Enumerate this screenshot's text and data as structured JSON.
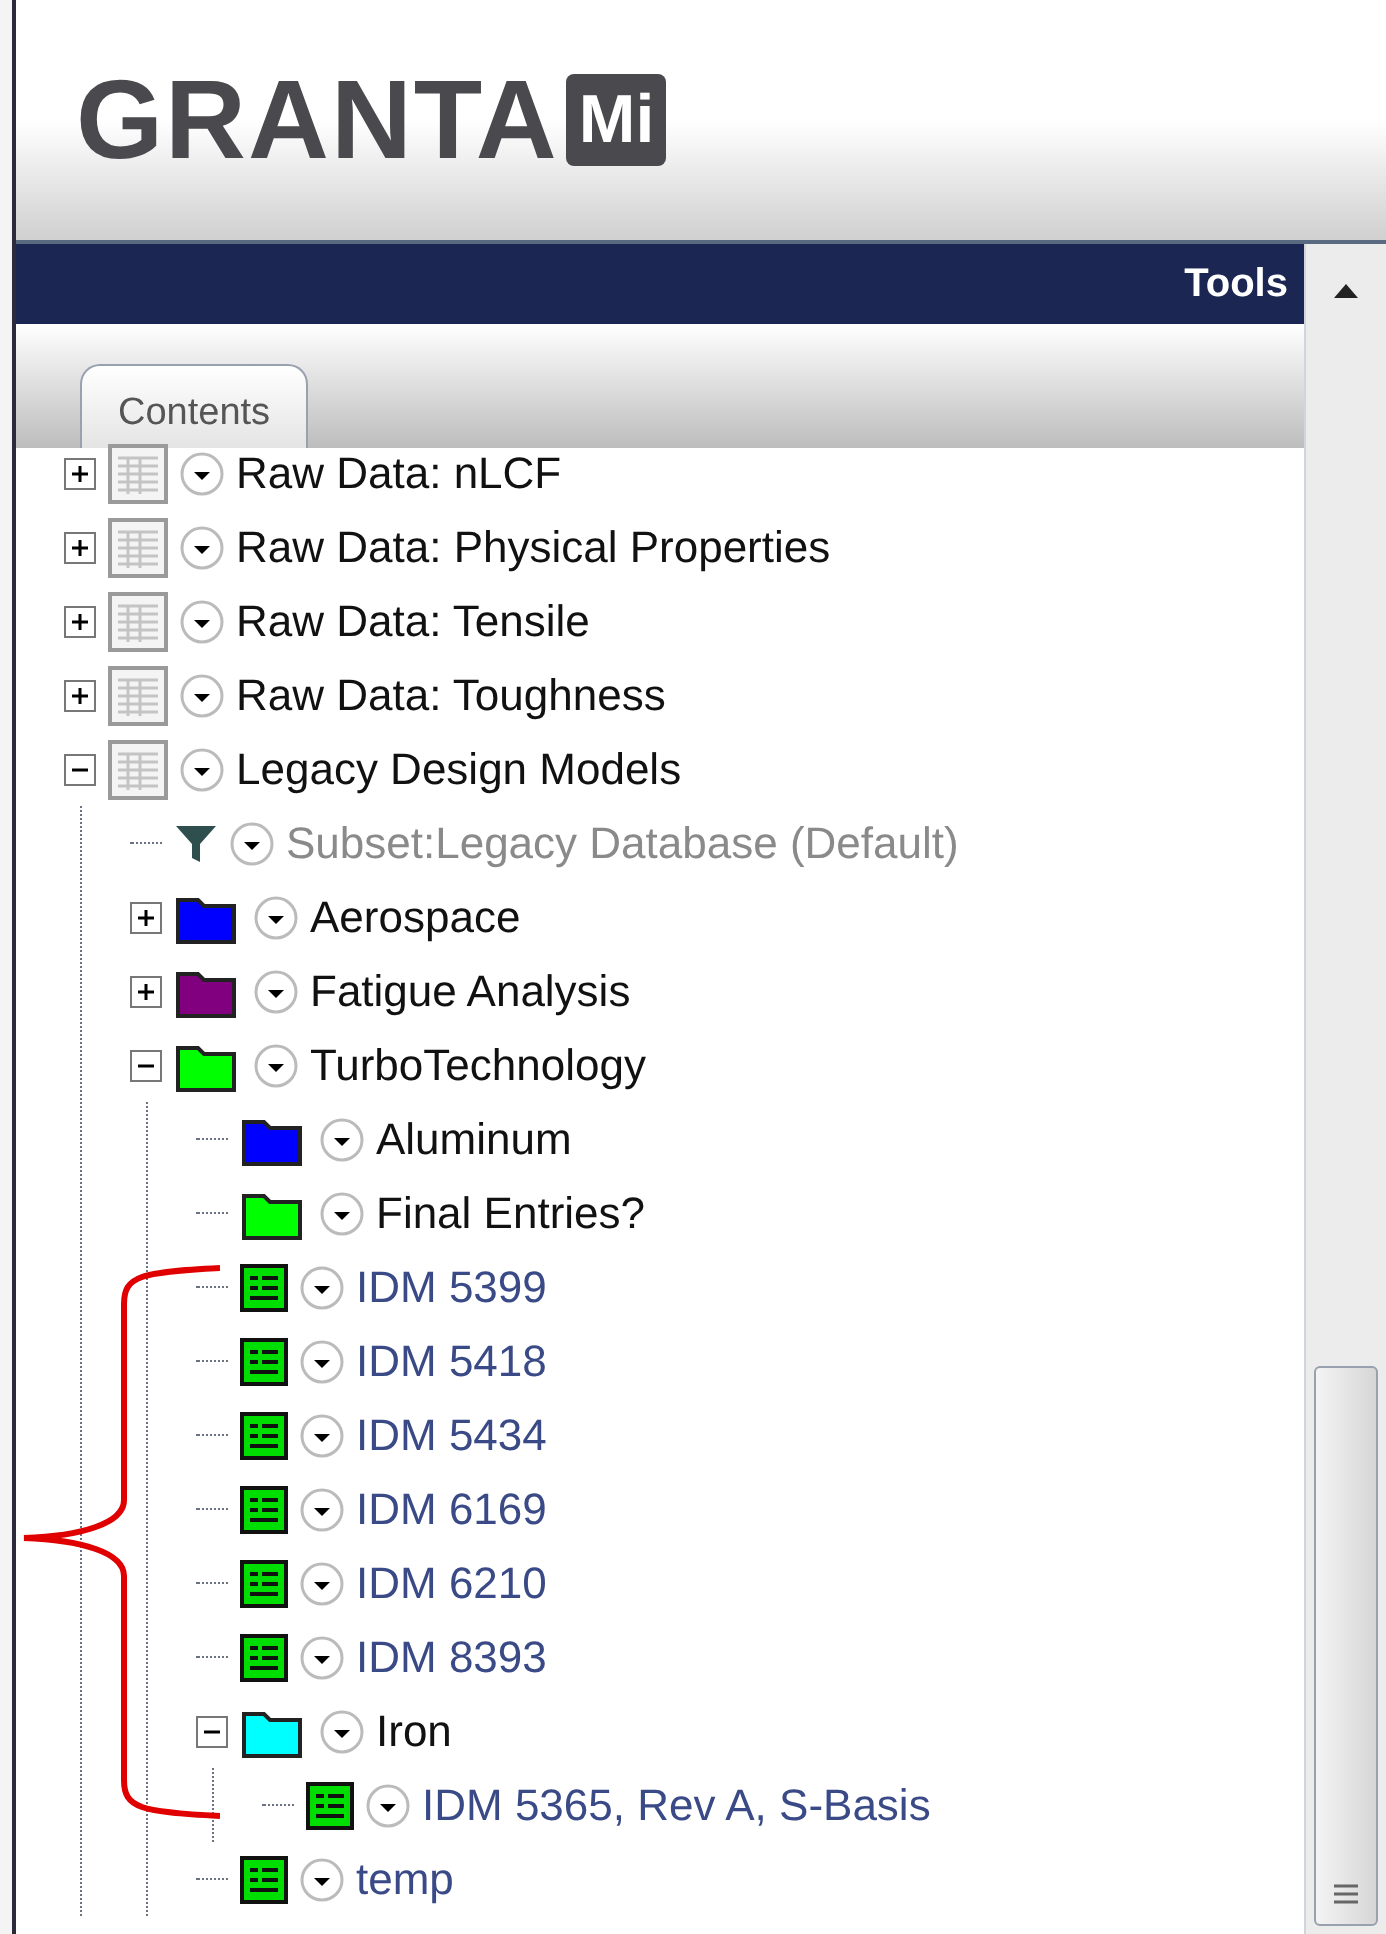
{
  "logo": {
    "name": "GRANTA",
    "badge": "Mi"
  },
  "header": {
    "title": "Tools"
  },
  "tabs": [
    {
      "label": "Contents",
      "selected": true
    }
  ],
  "tree": [
    {
      "kind": "table",
      "label": "Raw Data: nLCF",
      "expanded": false
    },
    {
      "kind": "table",
      "label": "Raw Data: Physical Properties",
      "expanded": false
    },
    {
      "kind": "table",
      "label": "Raw Data: Tensile",
      "expanded": false
    },
    {
      "kind": "table",
      "label": "Raw Data: Toughness",
      "expanded": false
    },
    {
      "kind": "table",
      "label": "Legacy Design Models",
      "expanded": true,
      "children": [
        {
          "kind": "subset",
          "label": "Subset:Legacy Database (Default)"
        },
        {
          "kind": "folder",
          "label": "Aerospace",
          "color": "#0000ff",
          "expanded": false
        },
        {
          "kind": "folder",
          "label": "Fatigue Analysis",
          "color": "#800080",
          "expanded": false
        },
        {
          "kind": "folder",
          "label": "TurboTechnology",
          "color": "#00ff00",
          "expanded": true,
          "children": [
            {
              "kind": "folder",
              "label": "Aluminum",
              "color": "#0000ff"
            },
            {
              "kind": "folder",
              "label": "Final Entries?",
              "color": "#00ff00"
            },
            {
              "kind": "record",
              "label": "IDM 5399"
            },
            {
              "kind": "record",
              "label": "IDM 5418"
            },
            {
              "kind": "record",
              "label": "IDM 5434"
            },
            {
              "kind": "record",
              "label": "IDM 6169"
            },
            {
              "kind": "record",
              "label": "IDM 6210"
            },
            {
              "kind": "record",
              "label": "IDM 8393"
            },
            {
              "kind": "folder",
              "label": "Iron",
              "color": "#00ffff",
              "expanded": true,
              "children": [
                {
                  "kind": "record",
                  "label": "IDM 5365, Rev A, S-Basis"
                }
              ]
            },
            {
              "kind": "record",
              "label": "temp"
            }
          ]
        }
      ]
    }
  ]
}
